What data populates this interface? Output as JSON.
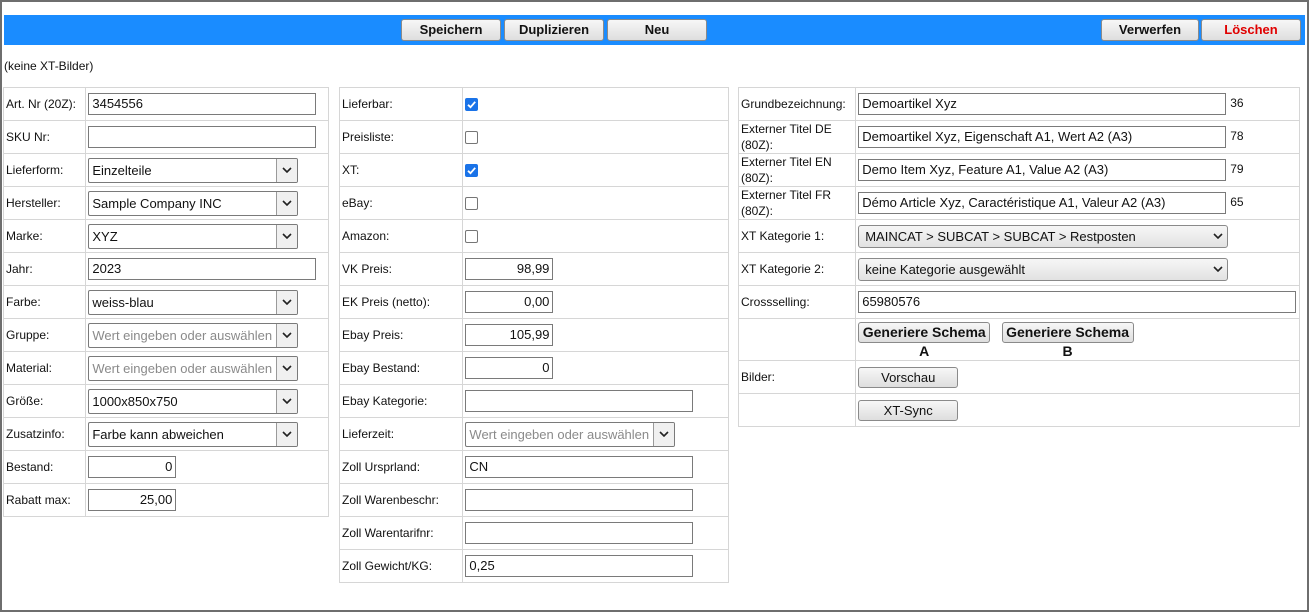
{
  "toolbar": {
    "save_label": "Speichern",
    "duplicate_label": "Duplizieren",
    "new_label": "Neu",
    "discard_label": "Verwerfen",
    "delete_label": "Löschen"
  },
  "note": "(keine XT-Bilder)",
  "col1": {
    "art_nr": {
      "label": "Art. Nr (20Z):",
      "value": "3454556"
    },
    "sku": {
      "label": "SKU Nr:",
      "value": ""
    },
    "lieferform": {
      "label": "Lieferform:",
      "value": "Einzelteile"
    },
    "hersteller": {
      "label": "Hersteller:",
      "value": "Sample Company INC"
    },
    "marke": {
      "label": "Marke:",
      "value": "XYZ"
    },
    "jahr": {
      "label": "Jahr:",
      "value": "2023"
    },
    "farbe": {
      "label": "Farbe:",
      "value": "weiss-blau"
    },
    "gruppe": {
      "label": "Gruppe:",
      "placeholder": "Wert eingeben oder auswählen"
    },
    "material": {
      "label": "Material:",
      "placeholder": "Wert eingeben oder auswählen"
    },
    "groesse": {
      "label": "Größe:",
      "value": "1000x850x750"
    },
    "zusatzinfo": {
      "label": "Zusatzinfo:",
      "value": "Farbe kann abweichen"
    },
    "bestand": {
      "label": "Bestand:",
      "value": "0"
    },
    "rabatt": {
      "label": "Rabatt max:",
      "value": "25,00"
    }
  },
  "col2": {
    "lieferbar": {
      "label": "Lieferbar:",
      "checked": true
    },
    "preisliste": {
      "label": "Preisliste:",
      "checked": false
    },
    "xt": {
      "label": "XT:",
      "checked": true
    },
    "ebay": {
      "label": "eBay:",
      "checked": false
    },
    "amazon": {
      "label": "Amazon:",
      "checked": false
    },
    "vk_preis": {
      "label": "VK Preis:",
      "value": "98,99"
    },
    "ek_preis": {
      "label": "EK Preis (netto):",
      "value": "0,00"
    },
    "ebay_preis": {
      "label": "Ebay Preis:",
      "value": "105,99"
    },
    "ebay_bestand": {
      "label": "Ebay Bestand:",
      "value": "0"
    },
    "ebay_kategorie": {
      "label": "Ebay Kategorie:",
      "value": ""
    },
    "lieferzeit": {
      "label": "Lieferzeit:",
      "placeholder": "Wert eingeben oder auswählen"
    },
    "zoll_ursprung": {
      "label": "Zoll Ursprland:",
      "value": "CN"
    },
    "zoll_waren": {
      "label": "Zoll Warenbeschr:",
      "value": ""
    },
    "zoll_tarif": {
      "label": "Zoll Warentarifnr:",
      "value": ""
    },
    "zoll_gewicht": {
      "label": "Zoll Gewicht/KG:",
      "value": "0,25"
    }
  },
  "col3": {
    "grund": {
      "label": "Grundbezeichnung:",
      "value": "Demoartikel Xyz",
      "count": "36"
    },
    "titel_de": {
      "label": "Externer Titel DE (80Z):",
      "value": "Demoartikel Xyz, Eigenschaft A1, Wert A2 (A3)",
      "count": "78"
    },
    "titel_en": {
      "label": "Externer Titel EN (80Z):",
      "value": "Demo Item Xyz, Feature A1, Value A2 (A3)",
      "count": "79"
    },
    "titel_fr": {
      "label": "Externer Titel FR (80Z):",
      "value": "Démo Article Xyz, Caractéristique A1, Valeur A2 (A3)",
      "count": "65"
    },
    "kat1": {
      "label": "XT Kategorie 1:",
      "value": "MAINCAT > SUBCAT > SUBCAT > Restposten"
    },
    "kat2": {
      "label": "XT Kategorie 2:",
      "value": "keine Kategorie ausgewählt"
    },
    "cross": {
      "label": "Crossselling:",
      "value": "65980576"
    },
    "schema_a": "Generiere Schema A",
    "schema_b": "Generiere Schema B",
    "bilder": {
      "label": "Bilder:",
      "preview_label": "Vorschau"
    },
    "xt_sync_label": "XT-Sync"
  },
  "icons": {
    "dropdown": "chevron-down-icon",
    "check": "checkmark-icon"
  },
  "colors": {
    "toolbar": "#1a8cff",
    "delete": "#e00000",
    "checkbox": "#1a73e8"
  }
}
